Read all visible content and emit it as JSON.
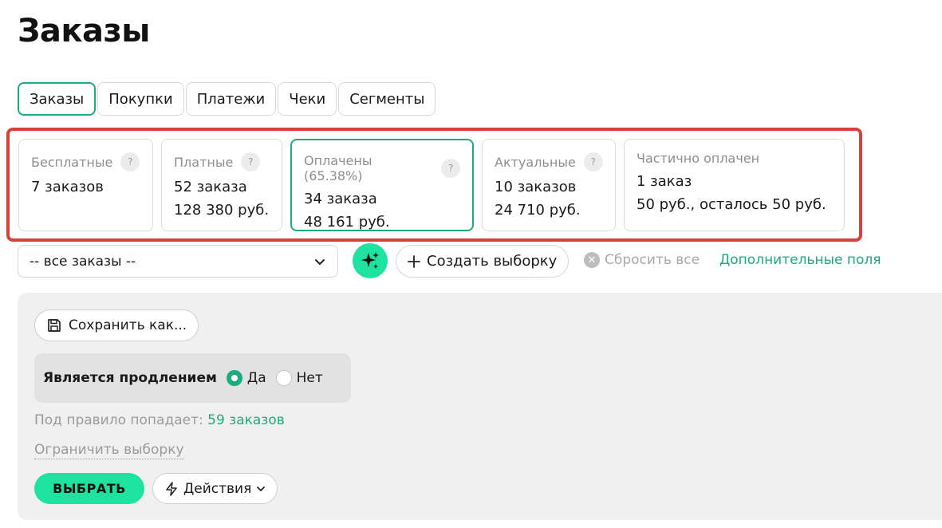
{
  "page": {
    "title": "Заказы"
  },
  "tabs": [
    {
      "label": "Заказы",
      "active": true
    },
    {
      "label": "Покупки"
    },
    {
      "label": "Платежи"
    },
    {
      "label": "Чеки"
    },
    {
      "label": "Сегменты"
    }
  ],
  "cards": [
    {
      "title": "Бесплатные",
      "help": "?",
      "line1": "7 заказов",
      "line2": ""
    },
    {
      "title": "Платные",
      "help": "?",
      "line1": "52 заказа",
      "line2": "128 380 руб."
    },
    {
      "title": "Оплачены (65.38%)",
      "help": "?",
      "line1": "34 заказа",
      "line2": "48 161 руб.",
      "active": true
    },
    {
      "title": "Актуальные",
      "help": "?",
      "line1": "10 заказов",
      "line2": "24 710 руб."
    },
    {
      "title": "Частично оплачен",
      "line1": "1 заказ",
      "line2": "50 руб., осталось 50 руб."
    }
  ],
  "filter": {
    "select_value": "-- все заказы --",
    "create_label": "Создать выборку",
    "reset_label": "Сбросить все",
    "extra_fields_label": "Дополнительные поля"
  },
  "panel": {
    "save_label": "Сохранить как...",
    "rule_label": "Является продлением",
    "option_yes": "Да",
    "option_no": "Нет",
    "selected_option": "Да",
    "match_prefix": "Под правило попадает:",
    "match_count": "59 заказов",
    "limit_label": "Ограничить выборку",
    "choose_label": "ВЫБРАТЬ",
    "actions_label": "Действия"
  },
  "colors": {
    "accent": "#1fa97f",
    "accent_bright": "#1ee3a0",
    "highlight": "#d9403a"
  }
}
